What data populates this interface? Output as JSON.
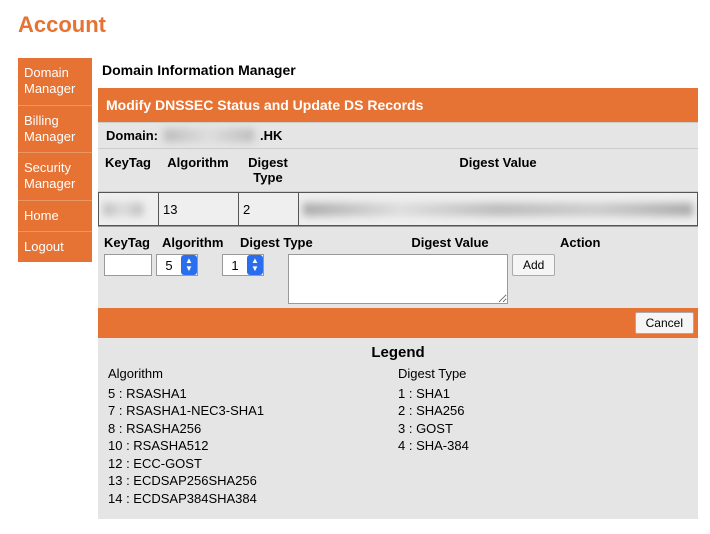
{
  "page_title": "Account",
  "sidebar": {
    "items": [
      {
        "label": "Domain Manager"
      },
      {
        "label": "Billing Manager"
      },
      {
        "label": "Security Manager"
      },
      {
        "label": "Home"
      },
      {
        "label": "Logout"
      }
    ]
  },
  "main": {
    "title": "Domain Information Manager",
    "subtitle": "Modify DNSSEC Status and Update DS Records",
    "domain_label": "Domain:",
    "domain_suffix": ".HK",
    "table": {
      "headers": {
        "keytag": "KeyTag",
        "algorithm": "Algorithm",
        "digest_type": "Digest Type",
        "digest_value": "Digest Value"
      },
      "rows": [
        {
          "keytag": "",
          "algorithm": "13",
          "digest_type": "2",
          "digest_value": ""
        }
      ]
    },
    "add_form": {
      "headers": {
        "keytag": "KeyTag",
        "algorithm": "Algorithm",
        "digest_type": "Digest Type",
        "digest_value": "Digest Value",
        "action": "Action"
      },
      "keytag_value": "",
      "algorithm_value": "5",
      "digest_type_value": "1",
      "digest_value": "",
      "add_button": "Add"
    },
    "cancel_button": "Cancel",
    "legend": {
      "title": "Legend",
      "algorithm_header": "Algorithm",
      "algorithms": [
        "5 : RSASHA1",
        "7 : RSASHA1-NEC3-SHA1",
        "8 : RSASHA256",
        "10 : RSASHA512",
        "12 : ECC-GOST",
        "13 : ECDSAP256SHA256",
        "14 : ECDSAP384SHA384"
      ],
      "digest_type_header": "Digest Type",
      "digest_types": [
        "1 : SHA1",
        "2 : SHA256",
        "3 : GOST",
        "4 : SHA-384"
      ]
    }
  }
}
